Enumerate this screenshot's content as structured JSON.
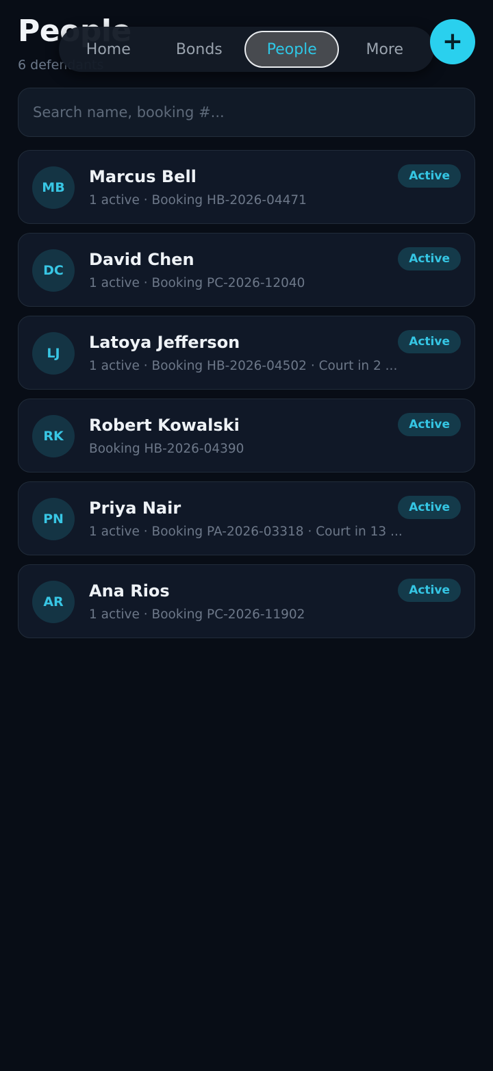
{
  "header": {
    "title": "People",
    "subtitle": "6 defendants"
  },
  "nav": {
    "tabs": [
      {
        "label": "Home"
      },
      {
        "label": "Bonds"
      },
      {
        "label": "People"
      },
      {
        "label": "More"
      }
    ],
    "active": "People"
  },
  "fab": {
    "icon": "plus-icon",
    "glyph": "+"
  },
  "search": {
    "placeholder": "Search name, booking #...",
    "value": ""
  },
  "colors": {
    "background": "#080d16",
    "accent": "#2ad0ee",
    "card": "#101827",
    "badge_bg": "#143a4a",
    "badge_text": "#35c6e4"
  },
  "people": [
    {
      "initials": "MB",
      "name": "Marcus Bell",
      "meta": "1 active · Booking HB-2026-04471",
      "status": "Active"
    },
    {
      "initials": "DC",
      "name": "David Chen",
      "meta": "1 active · Booking PC-2026-12040",
      "status": "Active"
    },
    {
      "initials": "LJ",
      "name": "Latoya Jefferson",
      "meta": "1 active · Booking HB-2026-04502 · Court in 2 ...",
      "status": "Active"
    },
    {
      "initials": "RK",
      "name": "Robert Kowalski",
      "meta": "Booking HB-2026-04390",
      "status": "Active"
    },
    {
      "initials": "PN",
      "name": "Priya Nair",
      "meta": "1 active · Booking PA-2026-03318 · Court in 13 ...",
      "status": "Active"
    },
    {
      "initials": "AR",
      "name": "Ana Rios",
      "meta": "1 active · Booking PC-2026-11902",
      "status": "Active"
    }
  ]
}
